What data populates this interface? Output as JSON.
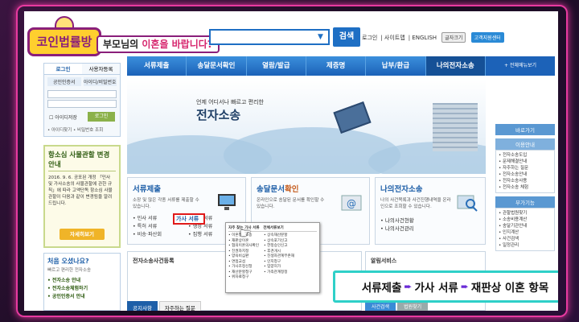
{
  "header": {
    "logo_text": "코인법률방",
    "subtitle_pre": "부모님의 ",
    "subtitle_hl": "이혼을 바랍니다?",
    "search_button": "검색",
    "top_links": [
      "로그인",
      "사이트맵",
      "ENGLISH"
    ],
    "top_btn1": "글자크기",
    "top_btn2": "고객지원센터"
  },
  "nav": {
    "items": [
      "서류제출",
      "송달문서확인",
      "열람/발급",
      "제증명",
      "납부/환급",
      "나의전자소송"
    ],
    "extra": "+ 전체메뉴보기"
  },
  "login": {
    "title": "로그인",
    "tab2": "사용자등록",
    "opt1": "공인인증서",
    "opt2": "아이디/비밀번호",
    "save_id": "아이디저장",
    "button": "로그인",
    "links": "• 아이디찾기  • 비밀번호 조회"
  },
  "notice": {
    "title": "항소심 사물관할 변경안내",
    "body": "2016. 9. 6. 공포된 개정 「민사 및 가사소송의 사물관할에 관한 규칙」에 따라 고액단독 항소심 사물관할이 다음과 같이 변경됨을 알려드립니다.",
    "more": "자세히보기"
  },
  "first": {
    "title": "처음 오셨나요?",
    "sub": "빠르고 편리한 전자소송",
    "items": [
      "• 전자소송 안내",
      "• 전자소송체험하기",
      "• 공인인증서 안내"
    ]
  },
  "hero": {
    "small": "언제 어디서나 빠르고 편리한",
    "big": "전자소송"
  },
  "services": {
    "s1_title": "서류제출",
    "s1_desc": "소장 및 많은 각종 서류를 제출할 수 있습니다.",
    "s1_items": [
      "• 민사 서류",
      "• 가사 서류",
      "• 특허 서류",
      "• 행정 서류",
      "• 비송·파산회",
      "• 집행 서류"
    ],
    "s1_hl": "가사 서류",
    "s2_title_a": "송달문서",
    "s2_title_b": "확인",
    "s2_desc": "온라인으로 송달된 문서를 확인할 수 있습니다.",
    "s3_title": "나의전자소송",
    "s3_desc": "나의 사건목록과 사건진행내역을 온라인으로 조회할 수 있습니다.",
    "s3_items": [
      "• 나의사건현황",
      "• 나의사건관리"
    ]
  },
  "popup": {
    "header": "자주 찾는 가사 서류",
    "header2": "전체서류보기",
    "col1": [
      "• 이혼청구소송",
      "• 재판상이혼",
      "• 협의이혼의사확인",
      "• 친권자지정",
      "• 양육비심판",
      "• 면접교섭",
      "• 가사조정신청",
      "• 재산분할청구",
      "• 위자료청구"
    ],
    "col2": [
      "• 상속재산분할",
      "• 상속포기신고",
      "• 한정승인신고",
      "• 후견개시",
      "• 친생자관계부존재",
      "• 인지청구",
      "• 입양허가",
      "• 가족관계정정"
    ]
  },
  "lower": {
    "left_title": "전자소송사건등록",
    "right_title": "알림서비스",
    "tabs": [
      "공지사항",
      "자주하는 질문"
    ],
    "tabs2": [
      "사건검색",
      "법원찾기"
    ]
  },
  "side": {
    "t1": "바로가기",
    "t1_sub": "이용안내",
    "list1": [
      "• 전자소송도입",
      "• 문제해결안내",
      "• 자주하는 질문",
      "• 전자소송안내",
      "• 전자소송사용",
      "• 전자소송 체험"
    ],
    "t2": "부가기능",
    "list2": [
      "• 관할법원찾기",
      "• 소송비용계산",
      "• 송달기관안내",
      "• 인지계산",
      "• 사건검색",
      "• 일정관리"
    ]
  },
  "caption": {
    "part1": "서류제출",
    "part2": "가사 서류",
    "part3": "재판상 이혼 항목",
    "arrow": "➨"
  }
}
